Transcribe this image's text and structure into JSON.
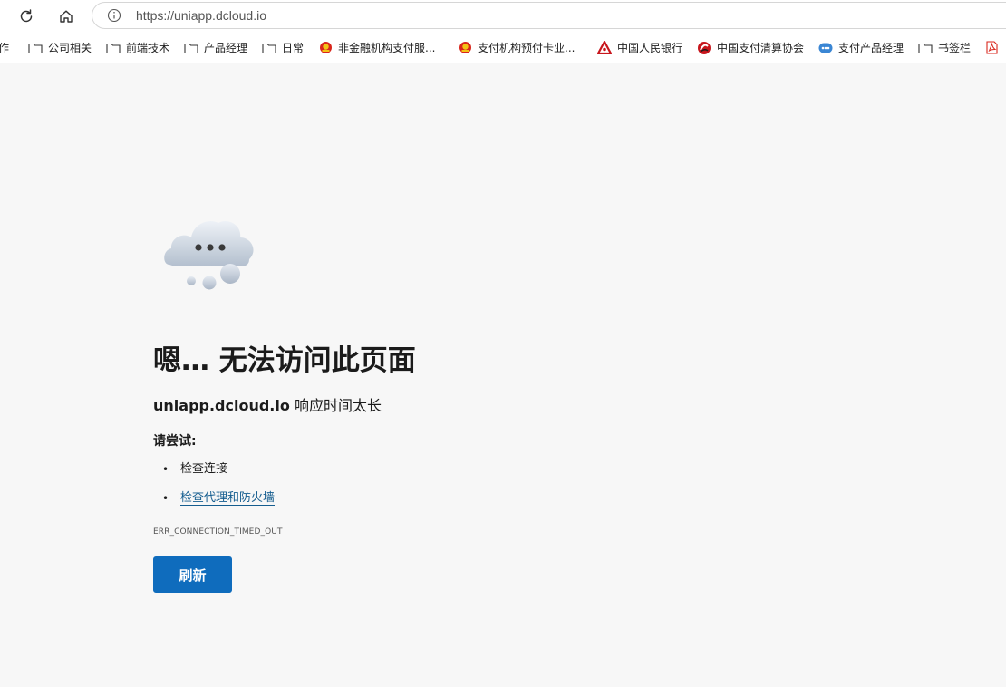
{
  "browser": {
    "url": "https://uniapp.dcloud.io",
    "bookmarks": [
      {
        "label": "工作",
        "icon": "folder-icon"
      },
      {
        "label": "公司相关",
        "icon": "folder-icon"
      },
      {
        "label": "前端技术",
        "icon": "folder-icon"
      },
      {
        "label": "产品经理",
        "icon": "folder-icon"
      },
      {
        "label": "日常",
        "icon": "folder-icon"
      },
      {
        "label": "非金融机构支付服...",
        "icon": "national-emblem-icon"
      },
      {
        "label": "支付机构预付卡业...",
        "icon": "national-emblem-icon"
      },
      {
        "label": "中国人民银行",
        "icon": "pboc-logo-icon"
      },
      {
        "label": "中国支付清算协会",
        "icon": "pcac-logo-icon"
      },
      {
        "label": "支付产品经理",
        "icon": "pm-logo-icon"
      },
      {
        "label": "书签栏",
        "icon": "folder-icon"
      }
    ]
  },
  "error_page": {
    "headline": "嗯… 无法访问此页面",
    "host": "uniapp.dcloud.io",
    "message": " 响应时间太长",
    "try_label": "请尝试:",
    "suggestions": [
      "检查连接",
      "检查代理和防火墙"
    ],
    "error_code": "ERR_CONNECTION_TIMED_OUT",
    "refresh_label": "刷新"
  },
  "colors": {
    "page_background": "#f7f7f7",
    "accent_button": "#0f6cbd",
    "link": "#155d8f"
  }
}
